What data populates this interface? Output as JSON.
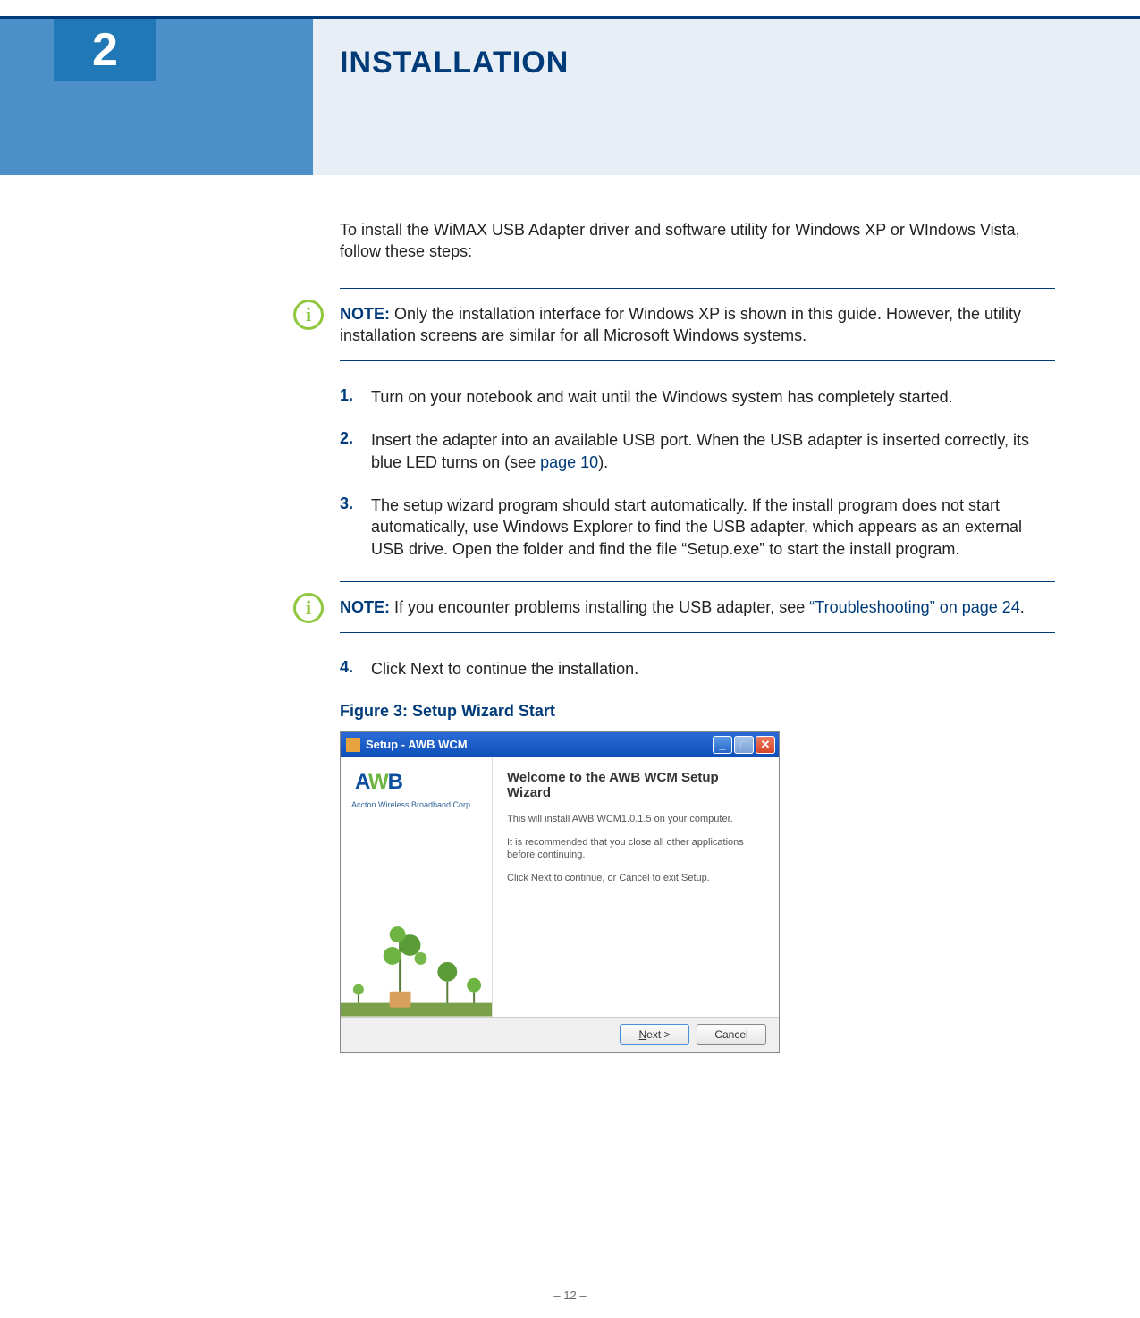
{
  "chapter": {
    "number": "2",
    "title": "INSTALLATION"
  },
  "intro": "To install the WiMAX USB Adapter driver and software utility for Windows XP or WIndows Vista, follow these steps:",
  "note1": {
    "label": "NOTE:",
    "text": " Only the installation interface for Windows XP is shown in this guide. However, the utility installation screens are similar for all Microsoft Windows systems."
  },
  "steps": [
    {
      "num": "1.",
      "text": "Turn on your notebook and wait until the Windows system has completely started."
    },
    {
      "num": "2.",
      "text_before": "Insert the adapter into an available USB port. When the USB adapter is inserted correctly, its blue LED turns on (see ",
      "link": "page 10",
      "text_after": ")."
    },
    {
      "num": "3.",
      "text": "The setup wizard program should start automatically. If the install program does not start automatically, use Windows Explorer to find the USB adapter, which appears as an external USB drive. Open the folder and find the file “Setup.exe” to start the install program."
    }
  ],
  "note2": {
    "label": "NOTE:",
    "text_before": " If you encounter problems installing the USB adapter, see ",
    "link": "“Troubleshooting” on page 24",
    "text_after": "."
  },
  "step4": {
    "num": "4.",
    "text": "Click Next to continue the installation."
  },
  "figure_caption": "Figure 3:  Setup Wizard Start",
  "wizard": {
    "title": "Setup - AWB WCM",
    "logo_text_a": "A",
    "logo_text_w": "W",
    "logo_text_b": "B",
    "logo_subtext": "Accton Wireless Broadband Corp.",
    "heading": "Welcome to the AWB WCM Setup Wizard",
    "line1": "This will install AWB WCM1.0.1.5 on your computer.",
    "line2": "It is recommended that you close all other applications before continuing.",
    "line3": "Click Next to continue, or Cancel to exit Setup.",
    "btn_next": "Next >",
    "btn_cancel": "Cancel",
    "btn_next_underline": "N"
  },
  "page_number": "–  12  –"
}
